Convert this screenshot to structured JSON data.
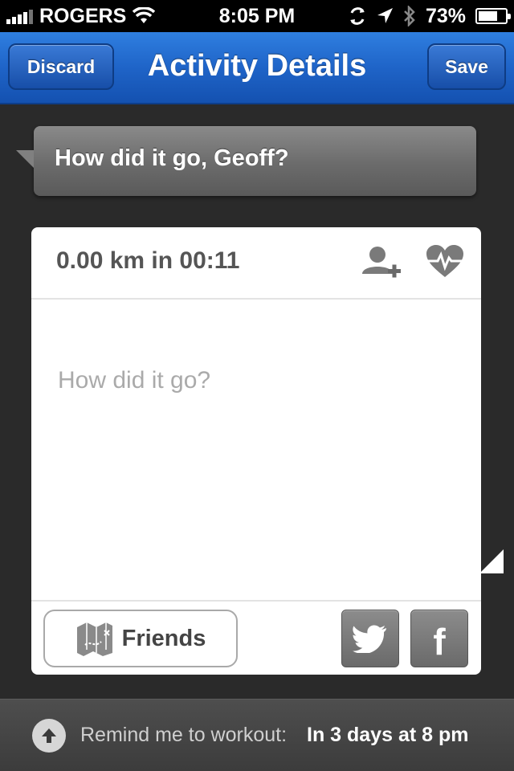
{
  "status_bar": {
    "carrier": "ROGERS",
    "time": "8:05 PM",
    "battery_percent": "73%",
    "battery_level": 0.73
  },
  "nav": {
    "title": "Activity Details",
    "discard_label": "Discard",
    "save_label": "Save"
  },
  "coach": {
    "message": "How did it go, Geoff?"
  },
  "activity": {
    "summary": "0.00 km in 00:11",
    "note_placeholder": "How did it go?",
    "note_value": ""
  },
  "share": {
    "friends_label": "Friends",
    "twitter_icon": "twitter-icon",
    "facebook_icon": "facebook-icon"
  },
  "reminder": {
    "label": "Remind me to workout:",
    "value": "In 3 days at 8 pm"
  },
  "colors": {
    "nav_blue": "#1f64c8",
    "background": "#2a2a2a",
    "card": "#ffffff",
    "share_button_gray": "#7a7a7a"
  }
}
